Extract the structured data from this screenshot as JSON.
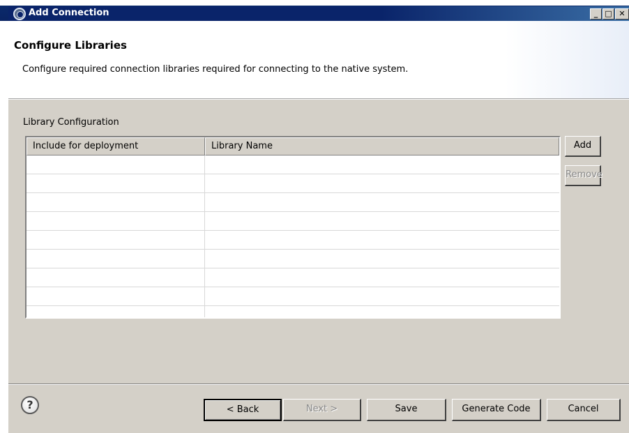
{
  "window": {
    "title": "Add Connection",
    "controls": [
      "minimize",
      "maximize",
      "close"
    ]
  },
  "header": {
    "title": "Configure Libraries",
    "description": "Configure required connection libraries required for connecting to the native system."
  },
  "library_group": {
    "label": "Library Configuration",
    "columns": [
      "Include for deployment",
      "Library Name"
    ],
    "rows": [],
    "add_label": "Add",
    "remove_label": "Remove"
  },
  "footer": {
    "back_label": "< Back",
    "next_label": "Next >",
    "save_label": "Save",
    "generate_label": "Generate Code",
    "cancel_label": "Cancel"
  },
  "icons": {
    "app": "eclipse-gear-icon",
    "help": "help-question-icon"
  },
  "colors": {
    "titlebar": "#0a246a",
    "panel": "#d4d0c8",
    "disabled_text": "#8a8a8a"
  }
}
